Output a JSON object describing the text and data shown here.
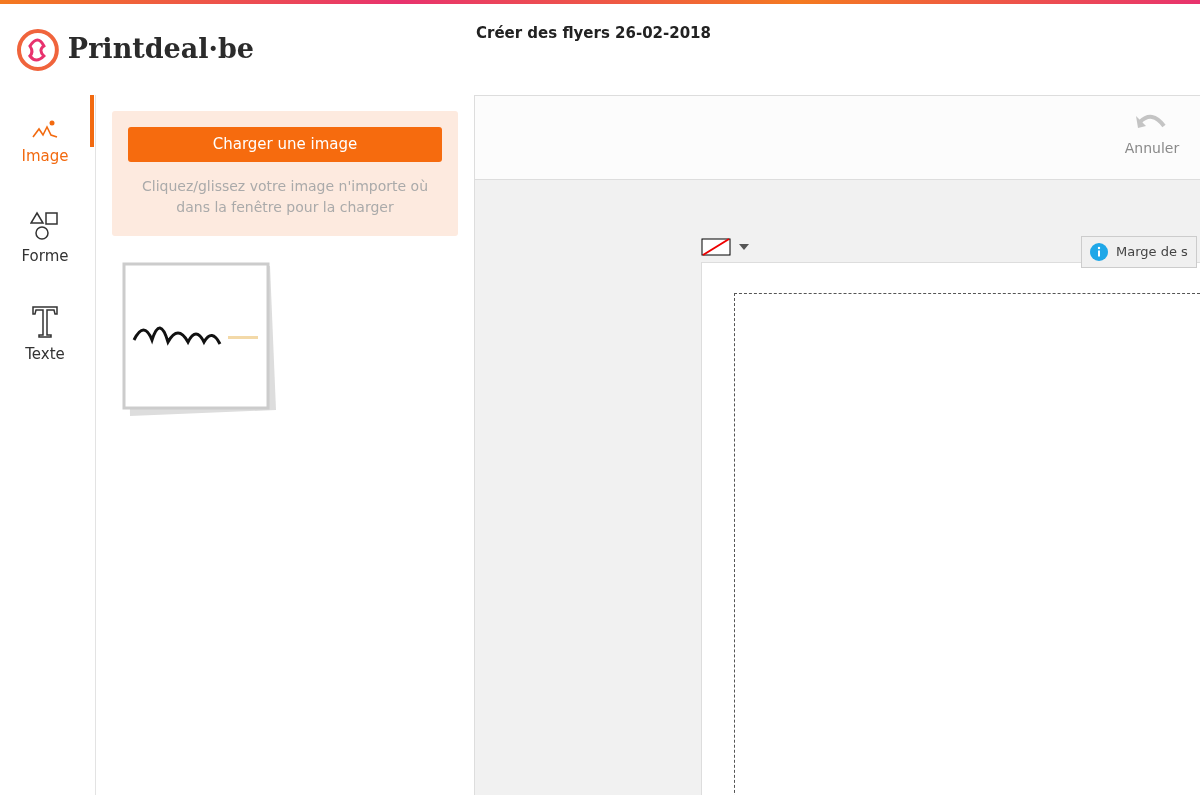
{
  "header": {
    "logo": "Printdeal·be",
    "title": "Créer des flyers 26-02-2018"
  },
  "nav": [
    {
      "label": "Image",
      "selected": true
    },
    {
      "kind": "shape",
      "label": "Forme",
      "selected": false
    },
    {
      "kind": "text",
      "label": "Texte",
      "selected": false
    }
  ],
  "upload": {
    "button": "Charger une image",
    "hint": "Cliquez/glissez votre image n'importe où dans la fenêtre pour la charger"
  },
  "toolbar": {
    "undo": {
      "label": "Annuler",
      "disabled": true
    }
  },
  "canvas": {
    "tooltip": "Marge de s"
  }
}
